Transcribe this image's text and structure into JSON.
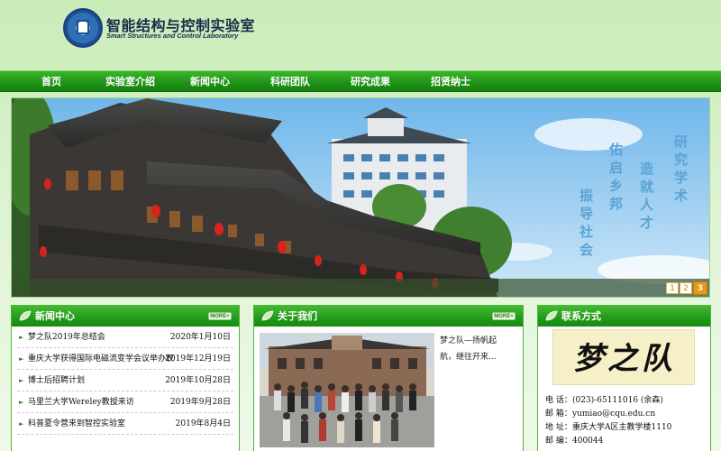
{
  "header": {
    "title": "智能结构与控制实验室",
    "subtitle": "Smart Structures and Control Laboratory"
  },
  "nav": {
    "items": [
      {
        "label": "首页"
      },
      {
        "label": "实验室介绍"
      },
      {
        "label": "新闻中心"
      },
      {
        "label": "科研团队"
      },
      {
        "label": "研究成果"
      },
      {
        "label": "招贤纳士"
      }
    ]
  },
  "banner": {
    "slogan_lines": [
      "研究学术",
      "造就人才",
      "佑启乡邦",
      "振导社会"
    ],
    "slides": [
      "1",
      "2",
      "3"
    ],
    "active_slide": "3"
  },
  "news": {
    "title": "新闻中心",
    "more_label": "MORE+",
    "items": [
      {
        "title": "梦之队2019年总结会",
        "date": "2020年1月10日"
      },
      {
        "title": "重庆大学获得国际电磁流变学会议举办权",
        "date": "2019年12月19日"
      },
      {
        "title": "博士后招聘计划",
        "date": "2019年10月28日"
      },
      {
        "title": "马里兰大学Wereley教授来访",
        "date": "2019年9月28日"
      },
      {
        "title": "科普夏令营来到智控实验室",
        "date": "2019年8月4日"
      }
    ]
  },
  "about": {
    "title": "关于我们",
    "more_label": "MORE+",
    "text": "梦之队—扬帆起航，继往开来..."
  },
  "contact": {
    "title": "联系方式",
    "logo_text": "梦之队",
    "phone_label": "电 话：",
    "phone": "(023)-65111016 (余森)",
    "email_label": "邮 箱：",
    "email": "yumiao@cqu.edu.cn",
    "address_label": "地 址：",
    "address": "重庆大学A区主教学楼1110",
    "postcode_label": "邮 编：",
    "postcode": "400044"
  },
  "colors": {
    "nav_green": "#1f9418",
    "panel_green": "#22991a",
    "bg_green": "#c9ecb8",
    "sky_blue": "#8cc8ef"
  }
}
